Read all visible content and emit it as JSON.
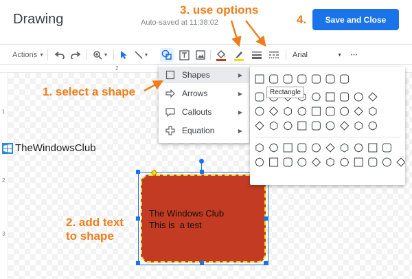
{
  "app": {
    "title": "Drawing",
    "autosave": "Auto-saved at 11:38:02",
    "save_label": "Save and Close"
  },
  "toolbar": {
    "actions_label": "Actions",
    "font": "Arial",
    "more_label": "•••",
    "icons": [
      "undo-icon",
      "redo-icon",
      "zoom-icon",
      "select-icon",
      "line-icon",
      "shape-icon",
      "textbox-icon",
      "image-icon",
      "fill-color-icon",
      "border-color-icon",
      "border-weight-icon",
      "border-dash-icon"
    ]
  },
  "ruler": {
    "top_num": "2",
    "left_num_1": "1",
    "left_num_2": "2",
    "left_num_3": "3"
  },
  "menu": {
    "items": [
      {
        "label": "Shapes",
        "icon": "square-icon"
      },
      {
        "label": "Arrows",
        "icon": "arrow-icon"
      },
      {
        "label": "Callouts",
        "icon": "callout-icon"
      },
      {
        "label": "Equation",
        "icon": "plus-icon"
      }
    ]
  },
  "submenu": {
    "tooltip": "Rectangle",
    "row_counts": [
      7,
      9,
      9,
      9,
      10,
      11
    ]
  },
  "shape": {
    "text_line_1": "The Windows Club",
    "text_line_2": "This is  a test",
    "fill_color": "#c23b22",
    "border_color": "#f5d90a"
  },
  "watermark": {
    "text": "TheWindowsClub"
  },
  "annotations": {
    "step1": "1. select a shape",
    "step2_line1": "2. add text",
    "step2_line2": "to shape",
    "step3": "3. use options",
    "step4": "4."
  },
  "colors": {
    "accent": "#1a73e8",
    "annotation": "#f07d1a"
  }
}
